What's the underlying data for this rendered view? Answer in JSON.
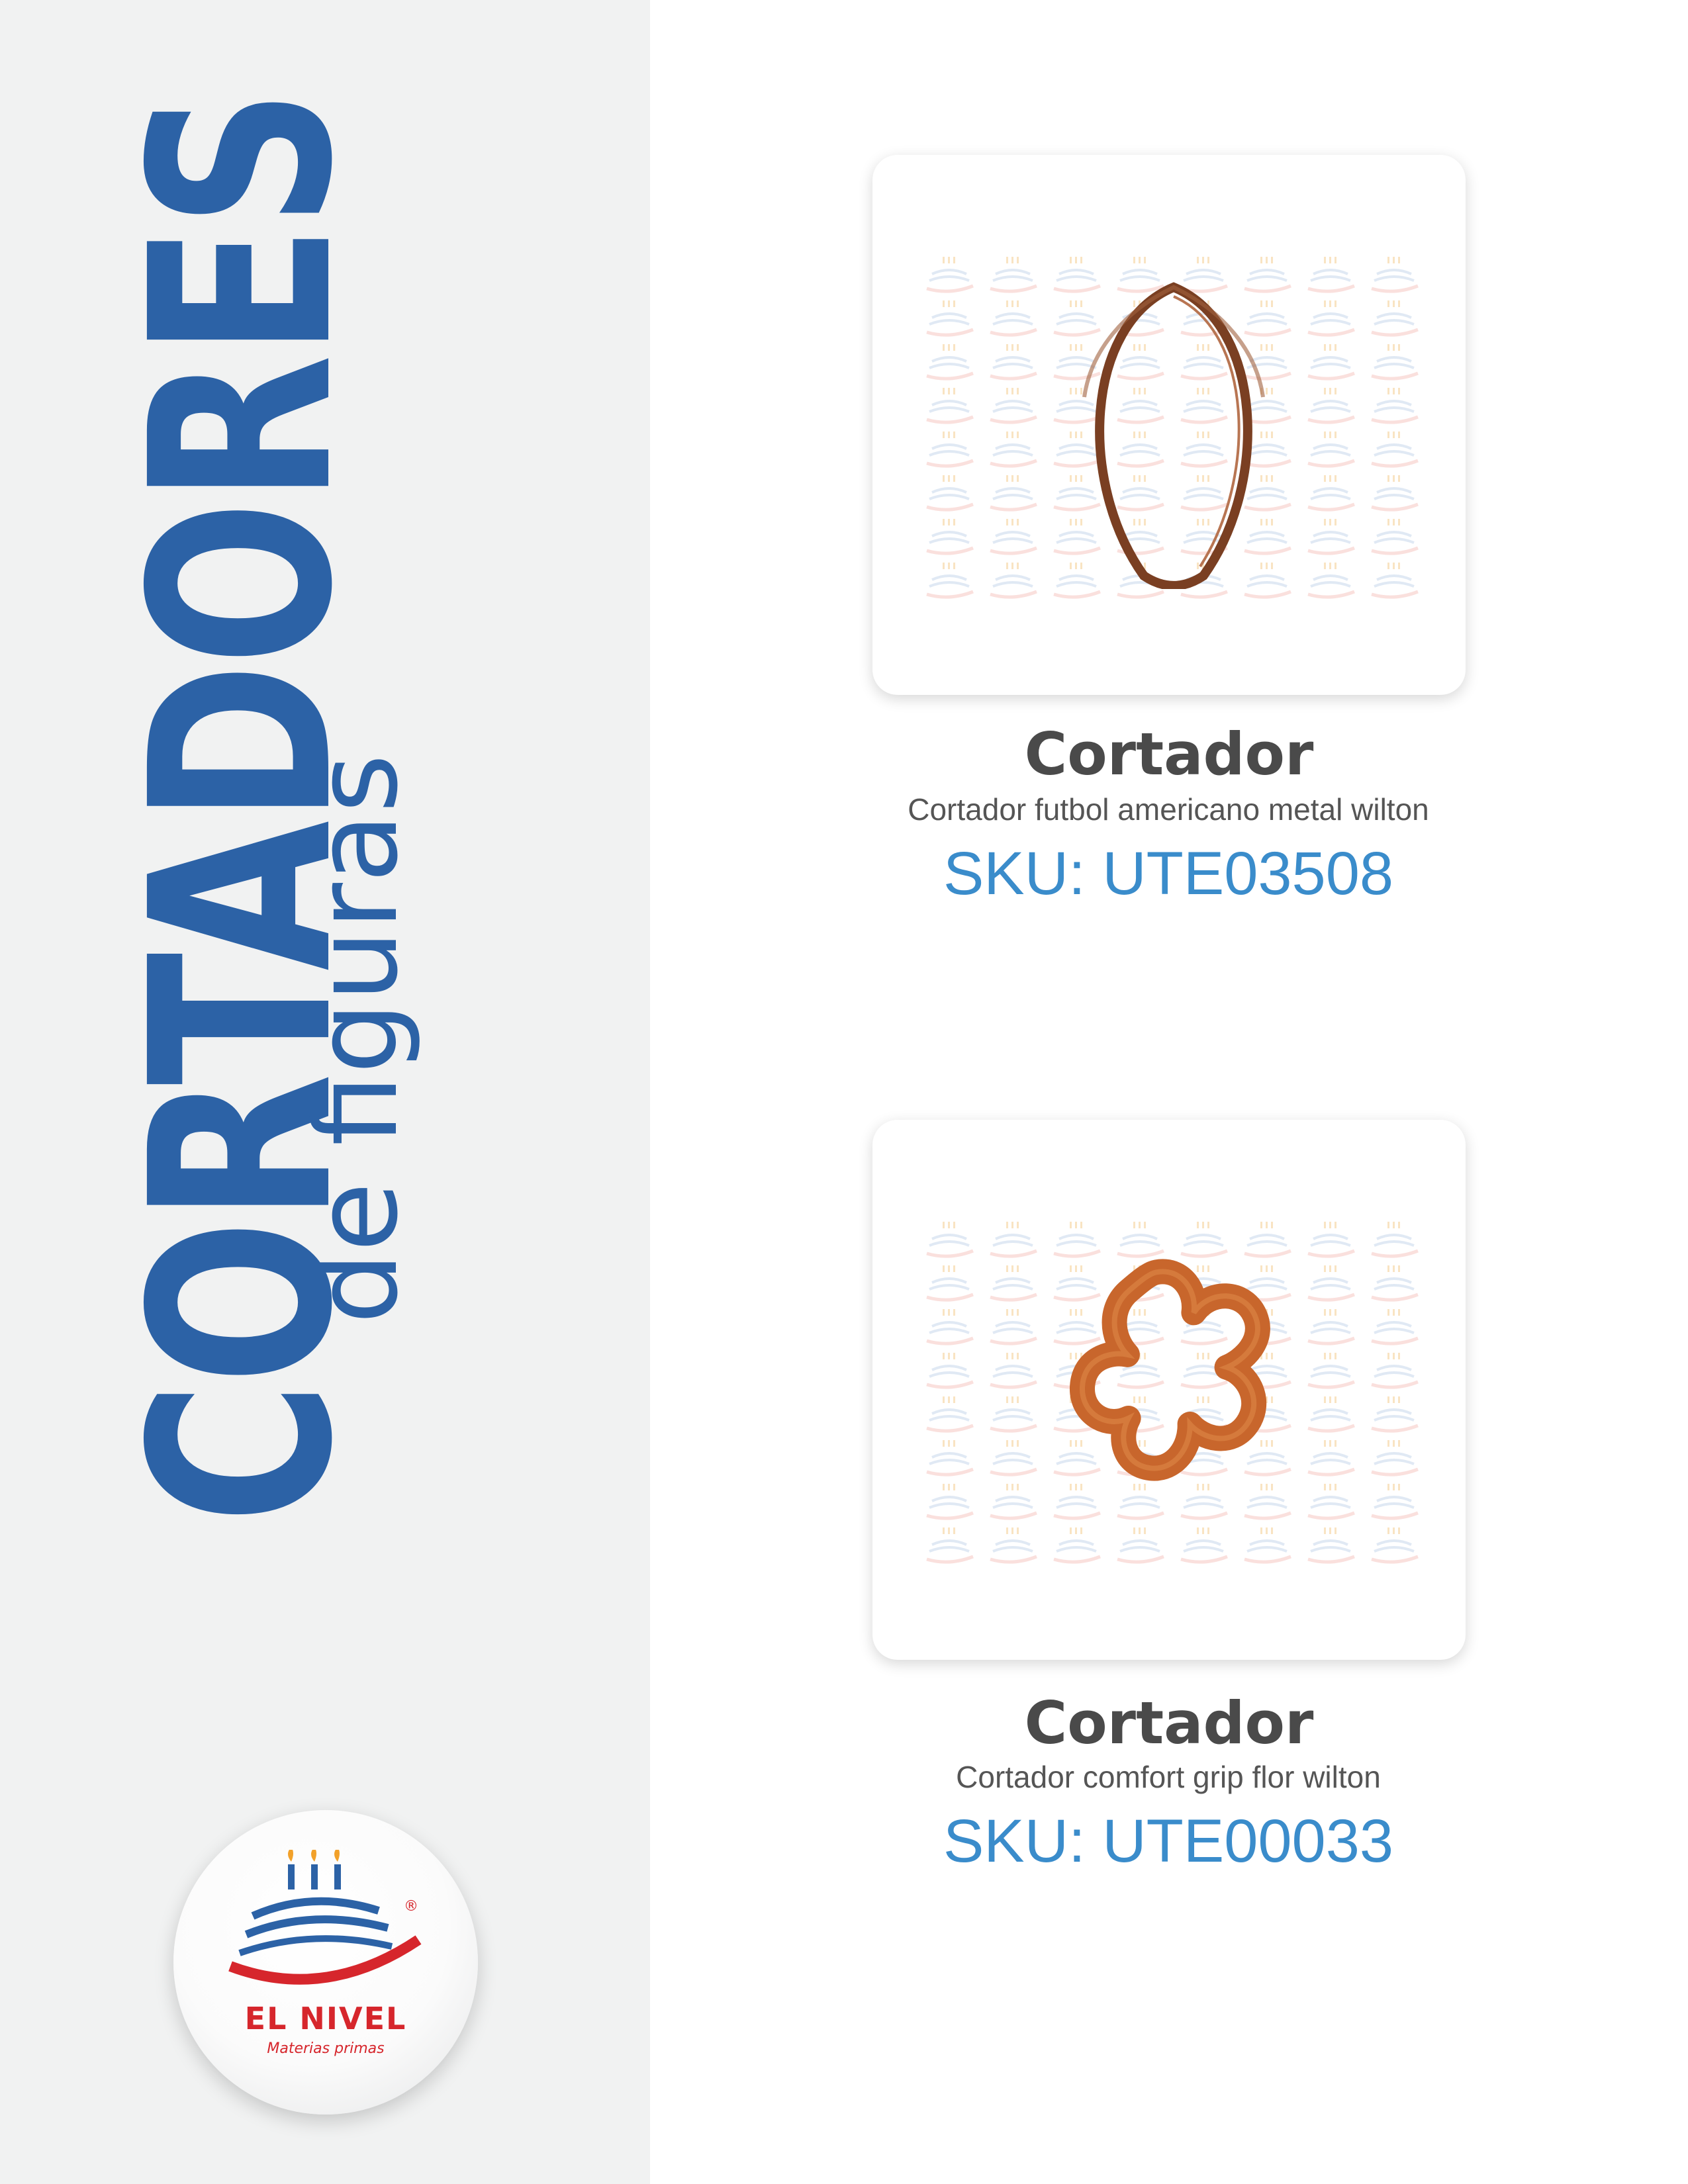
{
  "sidebar": {
    "title": "CORTADORES",
    "subtitle": "de figuras",
    "logo": {
      "name": "EL NIVEL",
      "tagline": "Materias primas",
      "registered": "®"
    }
  },
  "products": [
    {
      "title": "Cortador",
      "description": "Cortador futbol americano metal wilton",
      "sku": "SKU: UTE03508",
      "icon": "football-cutter-icon"
    },
    {
      "title": "Cortador",
      "description": "Cortador comfort grip flor wilton",
      "sku": "SKU: UTE00033",
      "icon": "flower-cutter-icon"
    }
  ],
  "colors": {
    "brand_blue": "#2c62a6",
    "sku_blue": "#3a8ccb",
    "logo_red": "#d6262c",
    "sidebar_bg": "#f1f2f2",
    "copper": "#8a4a2a",
    "orange": "#c8662c"
  }
}
